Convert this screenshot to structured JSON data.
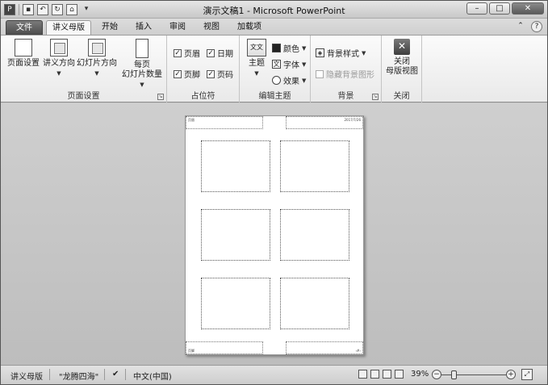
{
  "window": {
    "title": "演示文稿1 - Microsoft PowerPoint",
    "controls": {
      "minimize": "–",
      "maximize": "□",
      "close": "✕"
    }
  },
  "qat": {
    "app": "P",
    "save": "▪",
    "undo": "↶",
    "redo": "↻",
    "open": "⌂",
    "customize": "▾"
  },
  "tabs": {
    "file": "文件",
    "active": "讲义母版",
    "items": [
      "开始",
      "插入",
      "审阅",
      "视图",
      "加载项"
    ],
    "collapse": "⌃",
    "help": "?"
  },
  "ribbon": {
    "page_setup": {
      "label": "页面设置",
      "page_setup_btn": "页面设置",
      "handout_orientation": "讲义方向",
      "slide_orientation": "幻灯片方向",
      "slides_per_page_line1": "每页",
      "slides_per_page_line2": "幻灯片数量"
    },
    "placeholders": {
      "label": "占位符",
      "header": "页眉",
      "date": "日期",
      "footer": "页脚",
      "page_number": "页码"
    },
    "edit_theme": {
      "label": "编辑主题",
      "themes": "主题",
      "themes_icon_text": "文文",
      "colors": "颜色",
      "fonts": "字体",
      "fonts_icon": "文",
      "effects": "效果"
    },
    "background": {
      "label": "背景",
      "styles": "背景样式",
      "hide_graphics": "隐藏背景图形"
    },
    "close": {
      "label": "关闭",
      "close_line1": "关闭",
      "close_line2": "母版视图"
    }
  },
  "handout": {
    "header": "页眉",
    "date": "2017/7/26",
    "footer": "页脚",
    "page_number": "‹#›"
  },
  "status": {
    "view": "讲义母版",
    "theme": "\"龙腾四海\"",
    "language": "中文(中国)",
    "zoom": "39%",
    "zoom_out": "−",
    "zoom_in": "+"
  }
}
